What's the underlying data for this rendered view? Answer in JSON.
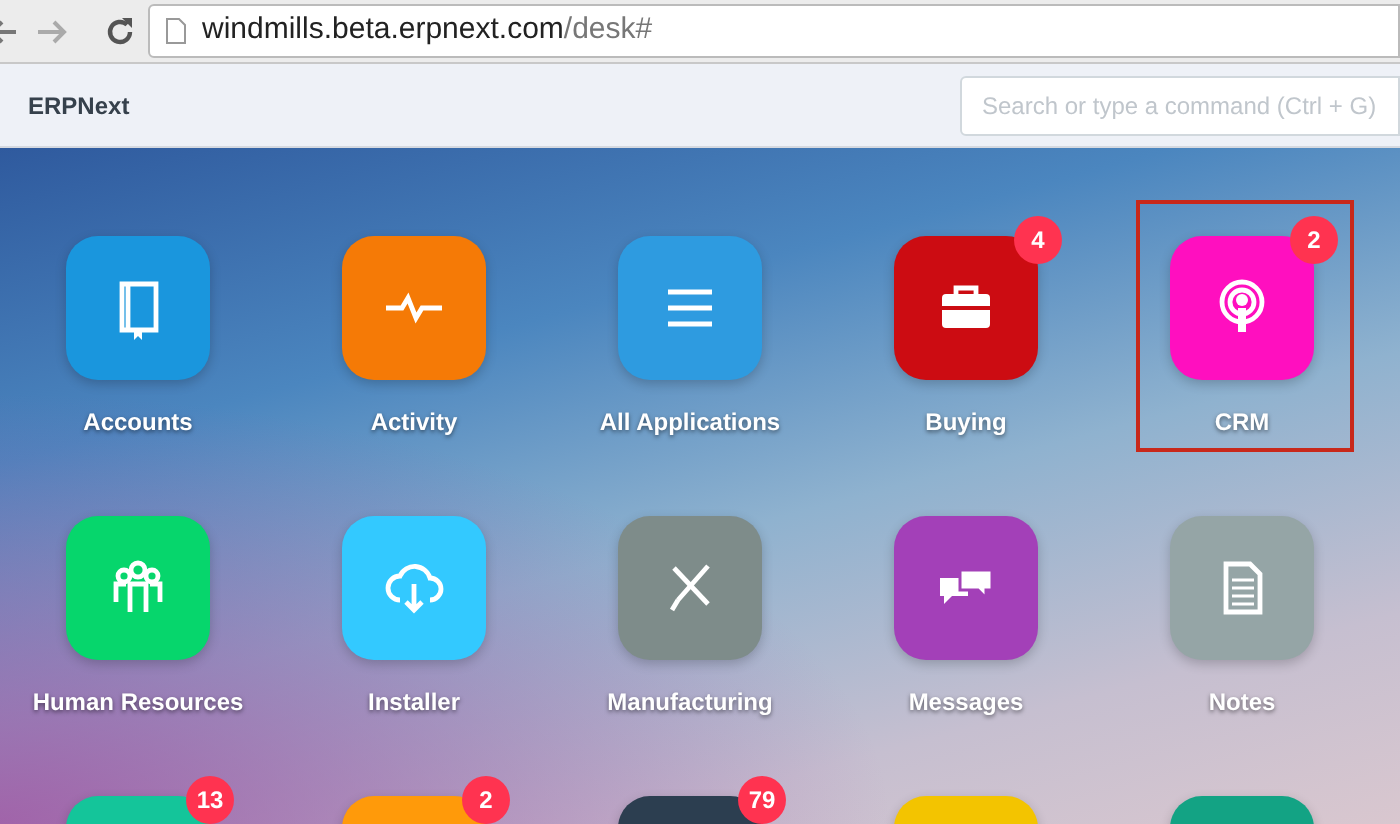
{
  "browser": {
    "url_host": "windmills.beta.erpnext.com",
    "url_path": "/desk#"
  },
  "navbar": {
    "brand": "ERPNext",
    "search": {
      "placeholder": "Search or type a command (Ctrl + G)"
    }
  },
  "apps": [
    {
      "label": "Accounts",
      "color": "#1a96dd",
      "highlighted": false
    },
    {
      "label": "Activity",
      "color": "#f57a06",
      "highlighted": false
    },
    {
      "label": "All Applications",
      "color": "#2e9be0",
      "highlighted": false
    },
    {
      "label": "Buying",
      "color": "#cc0c12",
      "badge": "4",
      "highlighted": false
    },
    {
      "label": "CRM",
      "color": "#ff0fbf",
      "badge": "2",
      "highlighted": true
    },
    {
      "label": "Human Resources",
      "color": "#06d66c",
      "highlighted": false
    },
    {
      "label": "Installer",
      "color": "#33c9ff",
      "highlighted": false
    },
    {
      "label": "Manufacturing",
      "color": "#7e8c8a",
      "highlighted": false
    },
    {
      "label": "Messages",
      "color": "#a340b8",
      "highlighted": false
    },
    {
      "label": "Notes",
      "color": "#95a5a6",
      "highlighted": false
    },
    {
      "color": "#14c59a",
      "badge": "13",
      "highlighted": false
    },
    {
      "color": "#ff9a0a",
      "badge": "2",
      "highlighted": false
    },
    {
      "color": "#2c3e50",
      "badge": "79",
      "highlighted": false
    },
    {
      "color": "#f3c400",
      "highlighted": false
    },
    {
      "color": "#13a384",
      "highlighted": false
    }
  ]
}
